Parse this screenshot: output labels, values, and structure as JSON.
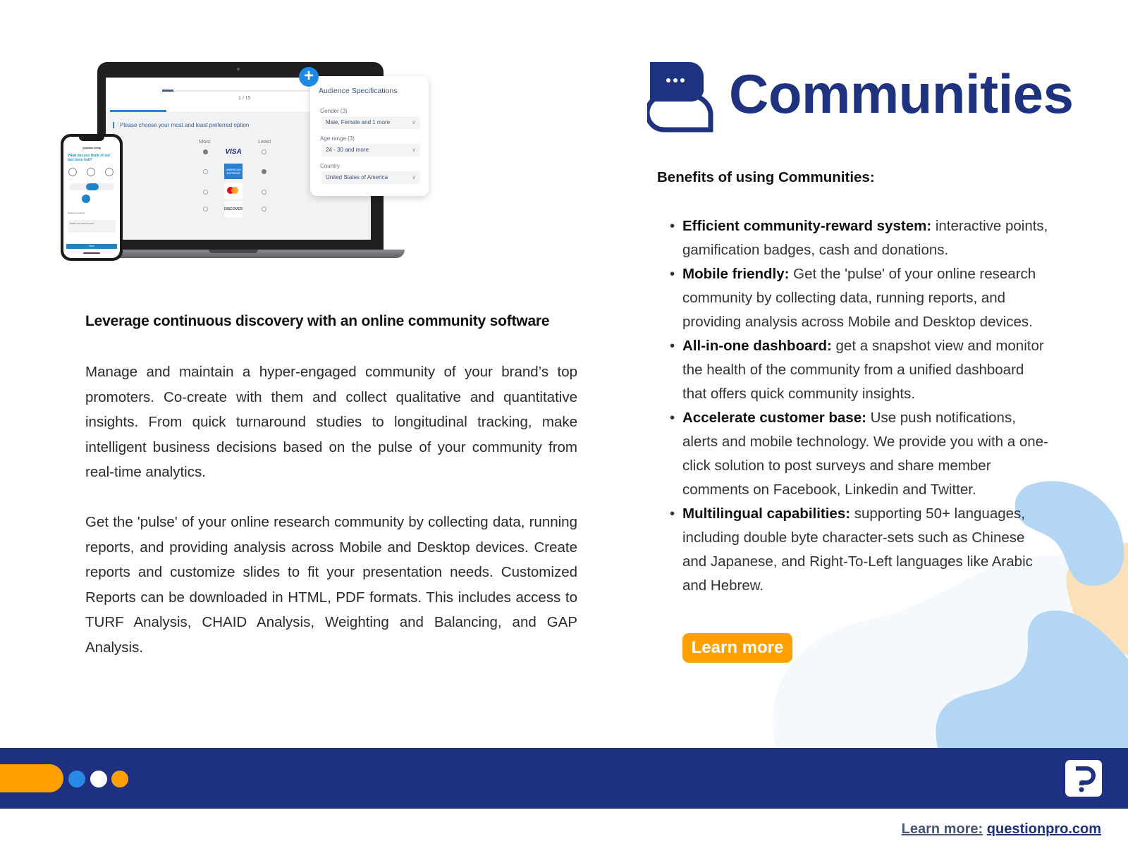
{
  "mockup": {
    "laptop": {
      "page_counter": "1 / 15",
      "progress_fraction": 0.07,
      "question": "Please choose your most and least preferred option",
      "col_most": "Most",
      "col_least": "Least",
      "options": [
        {
          "brand": "VISA",
          "most": true,
          "least": false
        },
        {
          "brand": "AMERICAN EXPRESS",
          "most": false,
          "least": true
        },
        {
          "brand": "mastercard",
          "most": false,
          "least": false
        },
        {
          "brand": "DISCOVER",
          "most": false,
          "least": false
        }
      ]
    },
    "phone": {
      "title": "Question Setup",
      "question": "What did you think of our last town hall?",
      "request_comment": "Request comment",
      "comment_placeholder": "What's your favorite part?",
      "next_label": "Next"
    },
    "audience_card": {
      "title": "Audience Specifications",
      "fields": [
        {
          "label": "Gender (3)",
          "value": "Male, Female and 1 more"
        },
        {
          "label": "Age range (3)",
          "value": "24 - 30 and more"
        },
        {
          "label": "Country",
          "value": "United States of America"
        }
      ]
    }
  },
  "left": {
    "heading": "Leverage continuous discovery with an online community software",
    "paragraphs": [
      "Manage and maintain a hyper-engaged community of your brand’s top promoters. Co-create with them and collect qualitative and quantitative insights. From quick turnaround studies to longitudinal tracking, make intelligent business decisions based on the pulse of your community from real-time analytics.",
      "Get the 'pulse' of your online research community by collecting data, running reports, and providing analysis across Mobile and Desktop devices. Create reports and customize slides to fit your presentation needs. Customized Reports can be downloaded in HTML, PDF formats. This includes access to TURF Analysis, CHAID Analysis, Weighting and Balancing, and GAP Analysis."
    ]
  },
  "right": {
    "brand_title": "Communities",
    "benefits_heading": "Benefits of using Communities:",
    "benefits": [
      {
        "title": "Efficient community-reward system:",
        "text": " interactive points, gamification badges, cash and donations."
      },
      {
        "title": "Mobile friendly:",
        "text": " Get the 'pulse' of your online research community by collecting data, running reports, and providing analysis across Mobile and Desktop devices."
      },
      {
        "title": "All-in-one dashboard:",
        "text": " get a snapshot view and monitor the health of the community from a unified dashboard that offers quick community insights."
      },
      {
        "title": "Accelerate customer base:",
        "text": " Use push notifications, alerts and mobile technology. We provide you with a one-click solution to post surveys and share member comments on Facebook, Linkedin and Twitter."
      },
      {
        "title": "Multilingual capabilities:",
        "text": " supporting 50+ languages, including double byte character-sets such as Chinese and Japanese, and Right-To-Left languages like Arabic and Hebrew."
      }
    ],
    "learn_more_button": "Learn more"
  },
  "footer": {
    "link_label": "Learn more:",
    "link_url_text": "questionpro.com"
  },
  "colors": {
    "brand_navy": "#1d3180",
    "accent_orange": "#ffa000",
    "accent_blue": "#2a88e6",
    "blob_blue": "#b3d6f4",
    "blob_peach": "#fae1b9"
  }
}
